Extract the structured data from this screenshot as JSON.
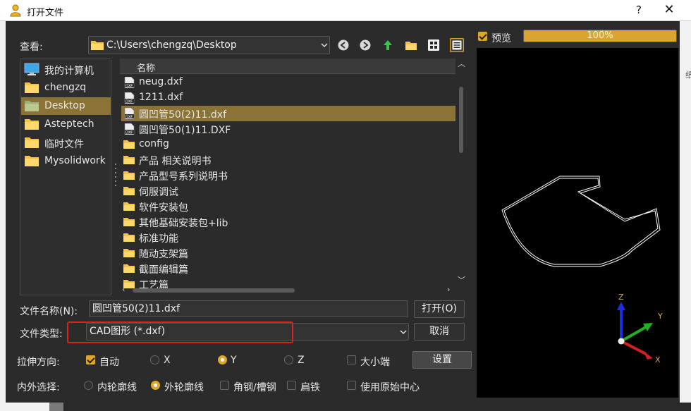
{
  "titlebar": {
    "title": "打开文件",
    "help": "?",
    "close": "✕"
  },
  "lookin": {
    "label": "查看:",
    "path": "C:\\Users\\chengzq\\Desktop"
  },
  "toolbar": {
    "icons": [
      "back-icon",
      "forward-icon",
      "up-icon",
      "new-folder-icon",
      "icon-view-icon",
      "list-view-icon"
    ]
  },
  "sidebar": {
    "items": [
      {
        "label": "我的计算机",
        "icon": "computer-icon",
        "selected": false
      },
      {
        "label": "chengzq",
        "icon": "folder-icon",
        "selected": false
      },
      {
        "label": "Desktop",
        "icon": "folder-icon",
        "selected": true
      },
      {
        "label": "Asteptech",
        "icon": "folder-icon",
        "selected": false
      },
      {
        "label": "临时文件",
        "icon": "folder-icon",
        "selected": false
      },
      {
        "label": "Mysolidwork",
        "icon": "folder-icon",
        "selected": false
      }
    ]
  },
  "filelist": {
    "column": "名称",
    "files": [
      {
        "name": "neug.dxf",
        "type": "dxf",
        "selected": false
      },
      {
        "name": "1211.dxf",
        "type": "dxf",
        "selected": false
      },
      {
        "name": "圆凹管50(2)11.dxf",
        "type": "dxf",
        "selected": true
      },
      {
        "name": "圆凹管50(1)11.DXF",
        "type": "dxf",
        "selected": false
      },
      {
        "name": "config",
        "type": "folder",
        "selected": false
      },
      {
        "name": "产品 相关说明书",
        "type": "folder",
        "selected": false
      },
      {
        "name": "产品型号系列说明书",
        "type": "folder",
        "selected": false
      },
      {
        "name": "伺服调试",
        "type": "folder",
        "selected": false
      },
      {
        "name": "软件安装包",
        "type": "folder",
        "selected": false
      },
      {
        "name": "其他基础安装包+lib",
        "type": "folder",
        "selected": false
      },
      {
        "name": "标准功能",
        "type": "folder",
        "selected": false
      },
      {
        "name": "随动支架篇",
        "type": "folder",
        "selected": false
      },
      {
        "name": "截面编辑篇",
        "type": "folder",
        "selected": false
      },
      {
        "name": "工艺篇",
        "type": "folder",
        "selected": false
      }
    ]
  },
  "filename": {
    "label": "文件名称(N):",
    "value": "圆凹管50(2)11.dxf",
    "open_button": "打开(O)"
  },
  "filetype": {
    "label": "文件类型:",
    "value": "CAD图形 (*.dxf)",
    "cancel_button": "取消"
  },
  "stretch": {
    "label": "拉伸方向:",
    "auto": {
      "label": "自动",
      "checked": true
    },
    "options": [
      {
        "label": "X",
        "selected": false
      },
      {
        "label": "Y",
        "selected": true
      },
      {
        "label": "Z",
        "selected": false
      }
    ],
    "endian": {
      "label": "大小端",
      "checked": false
    },
    "settings_button": "设置"
  },
  "inout": {
    "label": "内外选择:",
    "options": [
      {
        "label": "内轮廓线",
        "selected": false
      },
      {
        "label": "外轮廓线",
        "selected": true
      }
    ],
    "checks": [
      {
        "label": "角钢/槽钢",
        "checked": false
      },
      {
        "label": "扁铁",
        "checked": false
      },
      {
        "label": "使用原始中心",
        "checked": false
      }
    ]
  },
  "preview": {
    "checkbox_label": "预览",
    "checked": true,
    "progress": 100,
    "progress_text": "100%",
    "axes": {
      "x": "X",
      "y": "Y",
      "z": "Z"
    }
  },
  "colors": {
    "accent": "#e0a628",
    "selection": "#8b7335",
    "highlight": "#e02020",
    "axis_x": "#d42020",
    "axis_y": "#20b020",
    "axis_z": "#1a2ee0"
  }
}
